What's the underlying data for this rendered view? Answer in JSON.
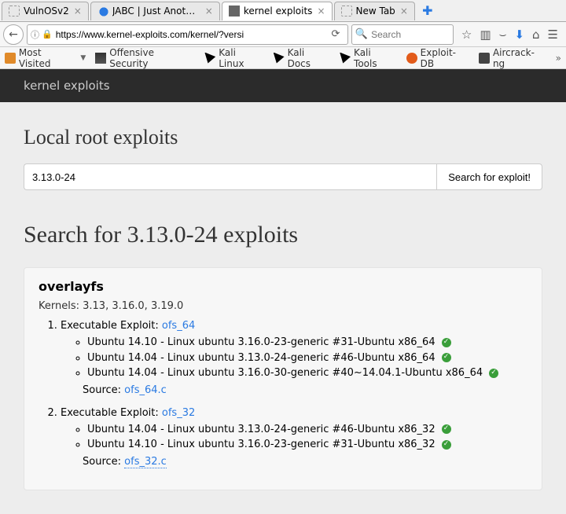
{
  "tabs": [
    {
      "label": "VulnOSv2",
      "favicon": "dotted"
    },
    {
      "label": "JABC | Just Anoth...",
      "favicon": "drupal"
    },
    {
      "label": "kernel exploits",
      "favicon": "cube",
      "active": true
    },
    {
      "label": "New Tab",
      "favicon": "dotted"
    }
  ],
  "nav": {
    "url": "https://www.kernel-exploits.com/kernel/?versi",
    "search_placeholder": "Search"
  },
  "bookmarks": {
    "most_visited": "Most Visited",
    "offensive": "Offensive Security",
    "kali_linux": "Kali Linux",
    "kali_docs": "Kali Docs",
    "kali_tools": "Kali Tools",
    "exploit_db": "Exploit-DB",
    "aircrack": "Aircrack-ng"
  },
  "site": {
    "brand": "kernel exploits",
    "h1": "Local root exploits",
    "search_value": "3.13.0-24",
    "search_btn": "Search for exploit!",
    "results_heading": "Search for 3.13.0-24 exploits",
    "exploit": {
      "name": "overlayfs",
      "kernels_label": "Kernels: 3.13, 3.16.0, 3.19.0",
      "exec_label": "Executable Exploit: ",
      "source_label": "Source: ",
      "items": [
        {
          "link": "ofs_64",
          "targets": [
            "Ubuntu 14.10 - Linux ubuntu 3.16.0-23-generic #31-Ubuntu x86_64",
            "Ubuntu 14.04 - Linux ubuntu 3.13.0-24-generic #46-Ubuntu x86_64",
            "Ubuntu 14.04 - Linux ubuntu 3.16.0-30-generic #40~14.04.1-Ubuntu x86_64"
          ],
          "source": "ofs_64.c"
        },
        {
          "link": "ofs_32",
          "targets": [
            "Ubuntu 14.04 - Linux ubuntu 3.13.0-24-generic #46-Ubuntu x86_32",
            "Ubuntu 14.10 - Linux ubuntu 3.16.0-23-generic #31-Ubuntu x86_32"
          ],
          "source": "ofs_32.c"
        }
      ]
    }
  }
}
